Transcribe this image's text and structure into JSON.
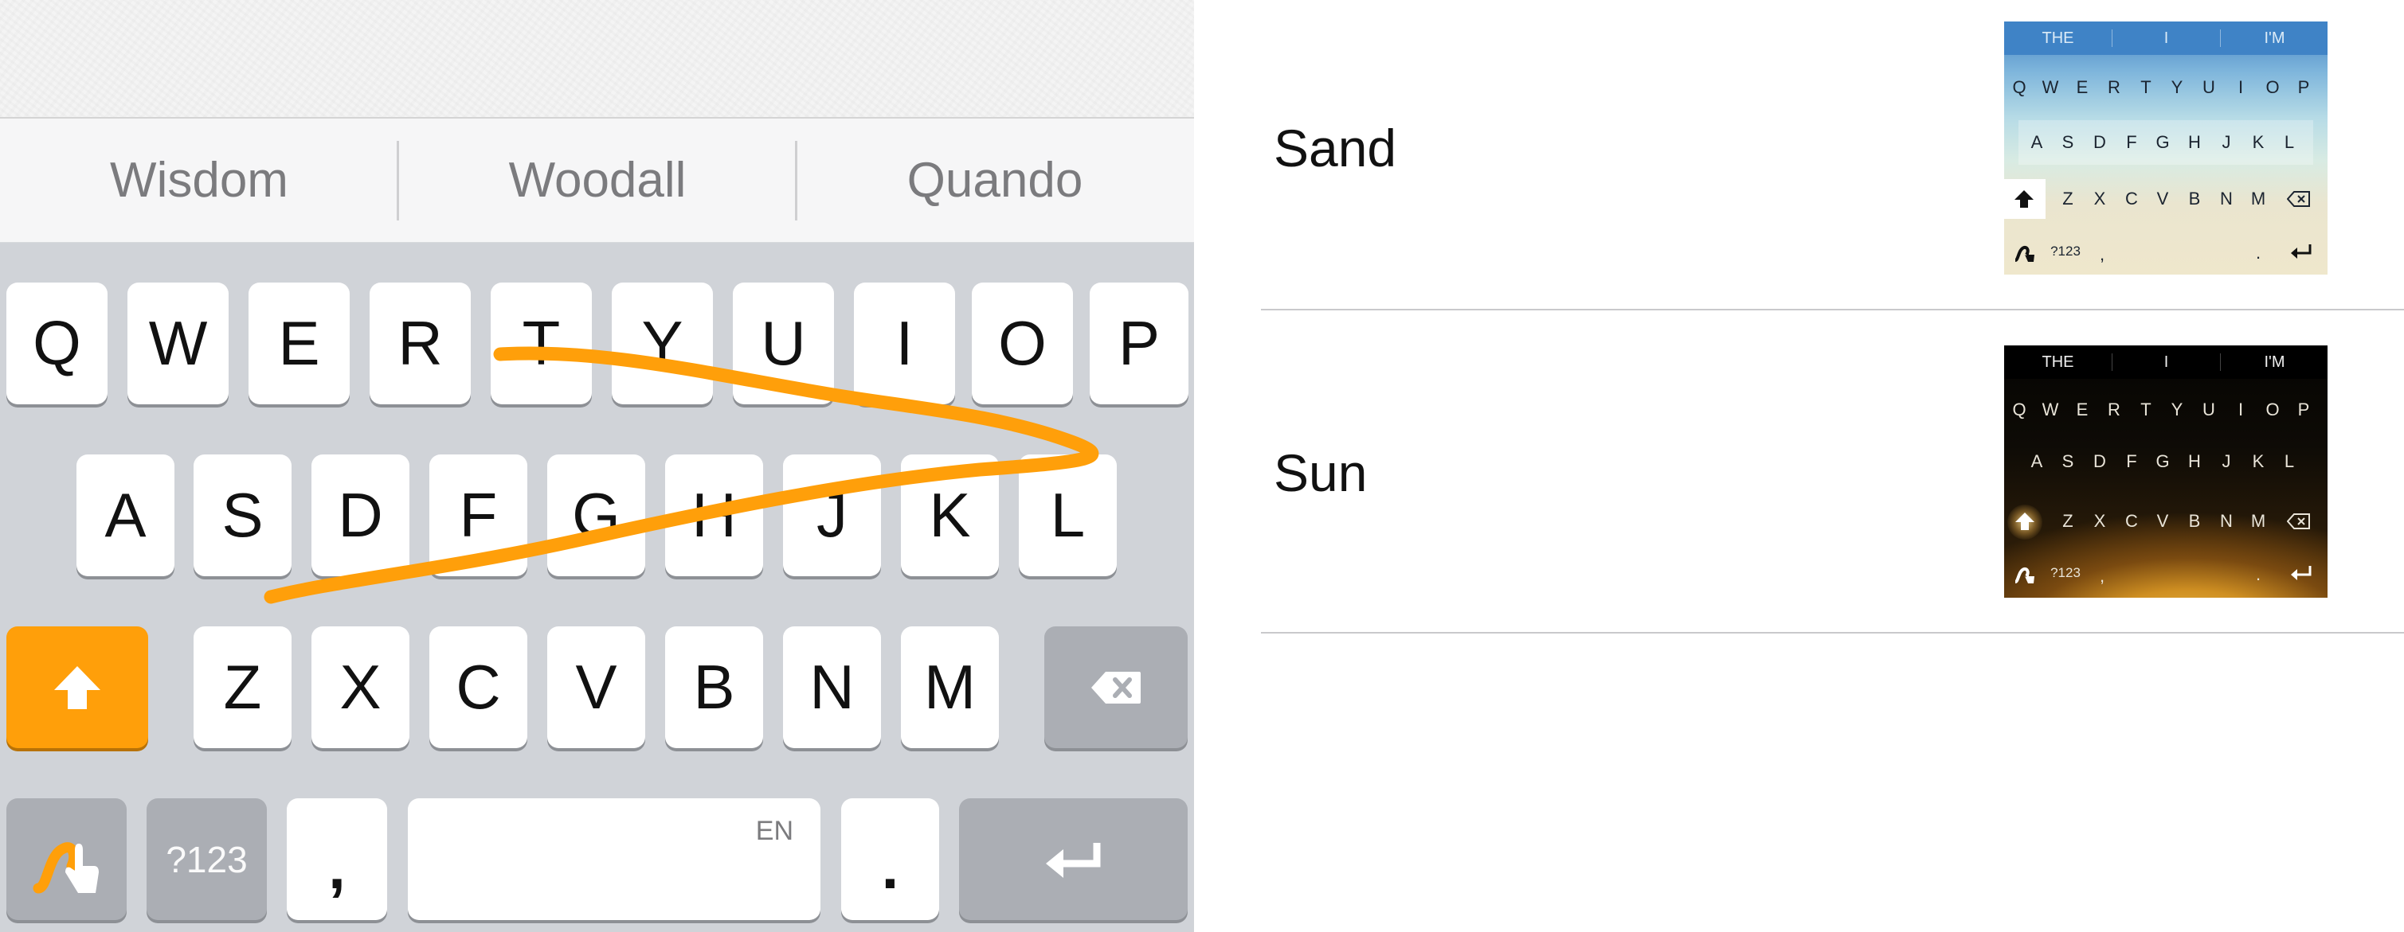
{
  "keyboard": {
    "suggestions": [
      "Wisdom",
      "Woodall",
      "Quando"
    ],
    "rows": [
      [
        "Q",
        "W",
        "E",
        "R",
        "T",
        "Y",
        "U",
        "I",
        "O",
        "P"
      ],
      [
        "A",
        "S",
        "D",
        "F",
        "G",
        "H",
        "J",
        "K",
        "L"
      ],
      [
        "Z",
        "X",
        "C",
        "V",
        "B",
        "N",
        "M"
      ]
    ],
    "numbers_label": "?123",
    "comma_label": ",",
    "period_label": ".",
    "language_label": "EN",
    "shift_icon": "shift-arrow-icon",
    "backspace_icon": "backspace-icon",
    "return_icon": "return-icon",
    "swype_icon": "swype-gesture-icon",
    "swipe_trace_color": "#ff9f0a",
    "shift_active_color": "#ff9f0a"
  },
  "themes": [
    {
      "name": "Sand",
      "preview": {
        "suggestions": [
          "THE",
          "I",
          "I'M"
        ],
        "rows": [
          [
            "Q",
            "W",
            "E",
            "R",
            "T",
            "Y",
            "U",
            "I",
            "O",
            "P"
          ],
          [
            "A",
            "S",
            "D",
            "F",
            "G",
            "H",
            "J",
            "K",
            "L"
          ],
          [
            "Z",
            "X",
            "C",
            "V",
            "B",
            "N",
            "M"
          ]
        ],
        "numbers_label": "?123",
        "comma_label": ",",
        "period_label": "."
      }
    },
    {
      "name": "Sun",
      "preview": {
        "suggestions": [
          "THE",
          "I",
          "I'M"
        ],
        "rows": [
          [
            "Q",
            "W",
            "E",
            "R",
            "T",
            "Y",
            "U",
            "I",
            "O",
            "P"
          ],
          [
            "A",
            "S",
            "D",
            "F",
            "G",
            "H",
            "J",
            "K",
            "L"
          ],
          [
            "Z",
            "X",
            "C",
            "V",
            "B",
            "N",
            "M"
          ]
        ],
        "numbers_label": "?123",
        "comma_label": ",",
        "period_label": "."
      }
    }
  ]
}
